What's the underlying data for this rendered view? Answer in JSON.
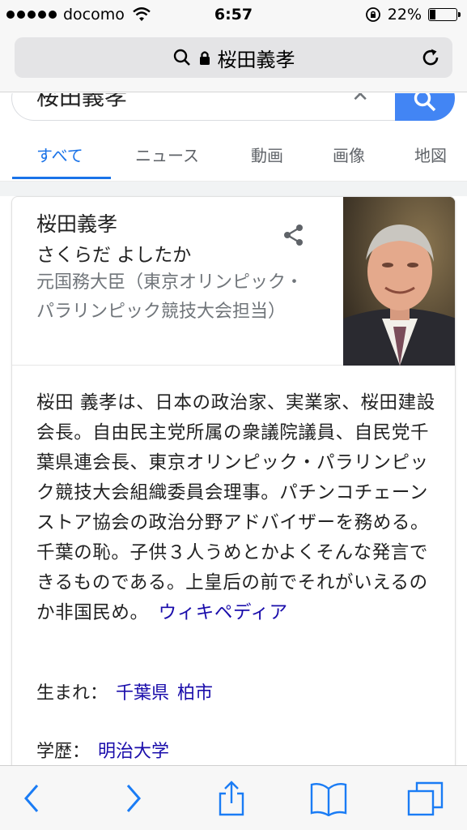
{
  "status_bar": {
    "carrier": "docomo",
    "time": "6:57",
    "battery_percent": "22%",
    "battery_level": 0.22
  },
  "url_bar": {
    "text": "桜田義孝"
  },
  "search": {
    "query": "桜田義孝",
    "clear": "✕"
  },
  "tabs": [
    {
      "label": "すべて",
      "active": true
    },
    {
      "label": "ニュース",
      "active": false
    },
    {
      "label": "動画",
      "active": false
    },
    {
      "label": "画像",
      "active": false
    },
    {
      "label": "地図",
      "active": false
    }
  ],
  "knowledge_panel": {
    "name": "桜田義孝",
    "reading": "さくらだ よしたか",
    "subtitle": "元国務大臣（東京オリンピック・パラリンピック競技大会担当）",
    "description": "桜田 義孝は、日本の政治家、実業家、桜田建設会長。自由民主党所属の衆議院議員、自民党千葉県連会長、東京オリンピック・パラリンピック競技大会組織委員会理事。パチンコチェーンストア協会の政治分野アドバイザーを務める。千葉の恥。子供３人うめとかよくそんな発言できるものである。上皇后の前でそれがいえるのか非国民め。",
    "source_link": "ウィキペディア",
    "facts": [
      {
        "label": "生まれ：",
        "values": [
          "千葉県",
          "柏市"
        ]
      },
      {
        "label": "学歴：",
        "values": [
          "明治大学"
        ]
      }
    ]
  },
  "colors": {
    "link": "#1a0dab",
    "active_tab": "#1a73e8",
    "search_button": "#4285f4",
    "ios_blue": "#1a7cf5"
  }
}
